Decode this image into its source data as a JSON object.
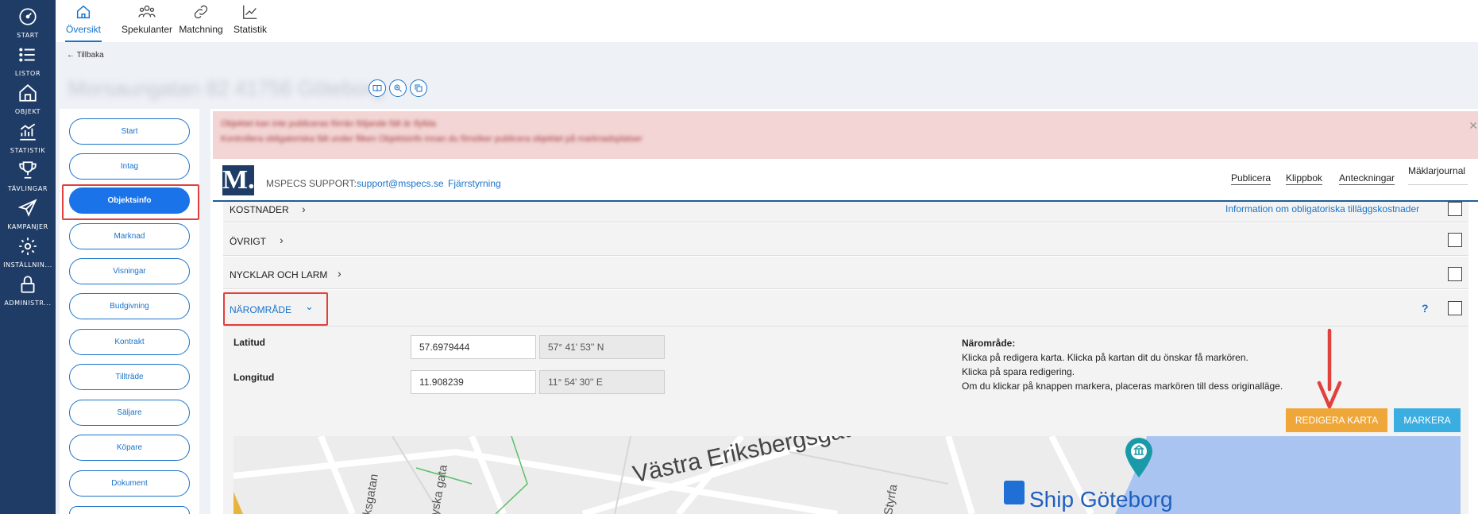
{
  "rail": {
    "items": [
      {
        "label": "START",
        "icon": "dashboard-icon"
      },
      {
        "label": "LISTOR",
        "icon": "list-icon"
      },
      {
        "label": "OBJEKT",
        "icon": "house-icon"
      },
      {
        "label": "STATISTIK",
        "icon": "chart-icon"
      },
      {
        "label": "TÄVLINGAR",
        "icon": "trophy-icon"
      },
      {
        "label": "KAMPANJER",
        "icon": "paper-plane-icon"
      },
      {
        "label": "INSTÄLLNIN...",
        "icon": "gear-icon"
      },
      {
        "label": "ADMINISTR...",
        "icon": "lock-icon"
      }
    ]
  },
  "tabs": [
    {
      "label": "Översikt",
      "icon": "home-icon"
    },
    {
      "label": "Spekulanter",
      "icon": "people-icon"
    },
    {
      "label": "Matchning",
      "icon": "link-icon"
    },
    {
      "label": "Statistik",
      "icon": "line-chart-icon"
    }
  ],
  "back": "← Tillbaka",
  "object_title": "Morsaungatan 82 41756 Göteborg",
  "subnav": [
    "Start",
    "Intag",
    "Objektsinfo",
    "Marknad",
    "Visningar",
    "Budgivning",
    "Kontrakt",
    "Tillträde",
    "Säljare",
    "Köpare",
    "Dokument"
  ],
  "alert": {
    "line1": "Objektet kan inte publiceras förrän följande fält är ifyllda",
    "line2": "Kontrollera obligatoriska fält under fliken Objektsinfo innan du försöker publicera objektet på marknadsplatser"
  },
  "header": {
    "logo": "M.",
    "support_label": "MSPECS SUPPORT:",
    "support_email": "support@mspecs.se",
    "remote": "Fjärrstyrning",
    "links": [
      "Publicera",
      "Klippbok",
      "Anteckningar",
      "Mäklarjournal"
    ]
  },
  "sections": {
    "kostnader": "KOSTNADER",
    "kostnader_info": "Information om obligatoriska tilläggskostnader",
    "ovrigt": "ÖVRIGT",
    "nycklar": "NYCKLAR OCH LARM",
    "naromrade": "NÄROMRÅDE",
    "help_q": "?"
  },
  "form": {
    "lat_label": "Latitud",
    "lat_value": "57.6979444",
    "lat_dms": "57° 41' 53'' N",
    "lon_label": "Longitud",
    "lon_value": "11.908239",
    "lon_dms": "11° 54' 30'' E"
  },
  "help": {
    "title": "Närområde:",
    "line1": "Klicka på redigera karta. Klicka på kartan dit du önskar få markören.",
    "line2": "Klicka på spara redigering.",
    "line3": "Om du klickar på knappen markera, placeras markören till dess originalläge."
  },
  "buttons": {
    "edit_map": "REDIGERA KARTA",
    "mark": "MARKERA"
  },
  "map": {
    "street1": "Västra Eriksbergsgatan",
    "street2": "ksgatan",
    "street3": "yska gata",
    "street4": "Styrfa",
    "poi": "Ship Göteborg"
  },
  "colors": {
    "accent": "#1a73c9",
    "rail": "#1f3c66",
    "edit_button": "#f0a73a",
    "mark_button": "#3aaee0",
    "highlight": "#e0413c"
  }
}
